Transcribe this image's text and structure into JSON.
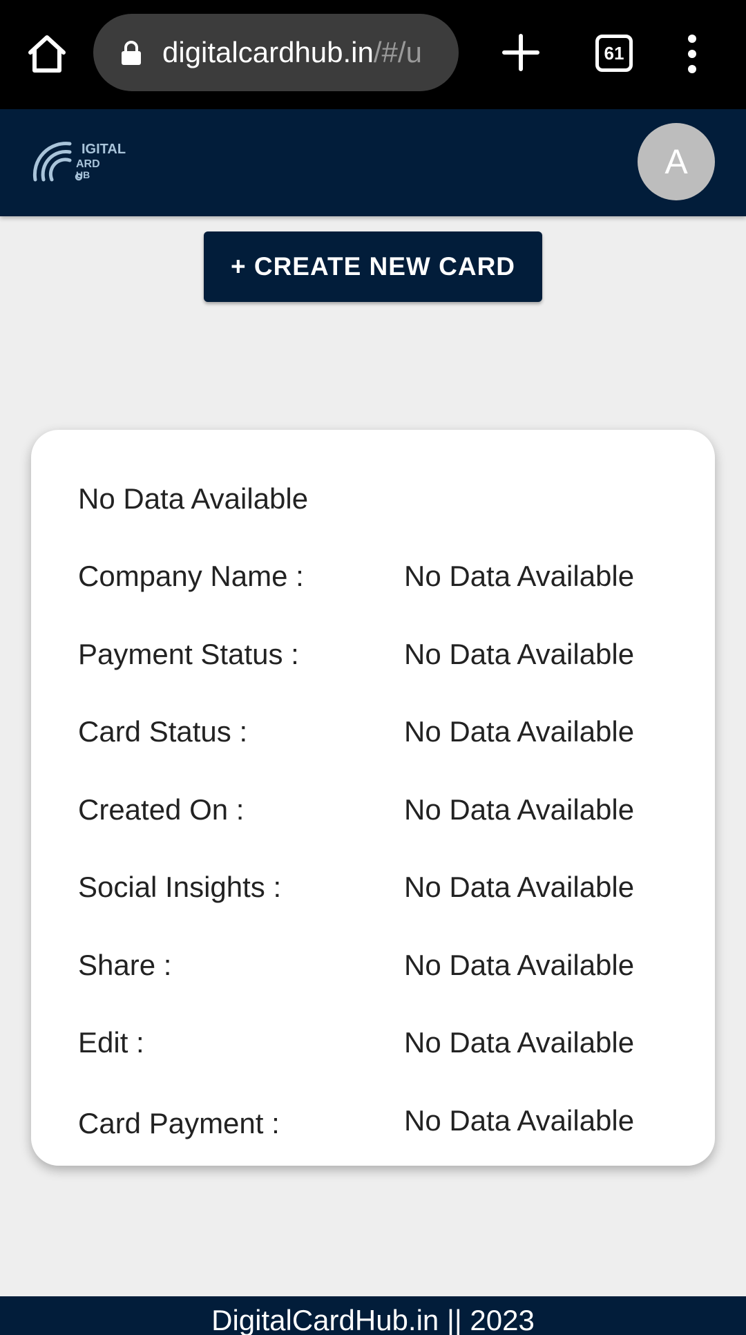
{
  "browser": {
    "url_main": "digitalcardhub.in",
    "url_rest": "/#/u",
    "tab_count": "61"
  },
  "header": {
    "logo_text": "DIGITAL CARD HUB",
    "avatar_letter": "A",
    "colors": {
      "navy": "#021d3a",
      "avatar_bg": "#bdbdbd"
    }
  },
  "actions": {
    "create_label": "+ CREATE NEW CARD"
  },
  "card": {
    "title": "No Data Available",
    "rows": [
      {
        "label": "Company Name :",
        "value": "No Data Available"
      },
      {
        "label": "Payment Status :",
        "value": "No Data Available"
      },
      {
        "label": "Card Status :",
        "value": "No Data Available"
      },
      {
        "label": "Created On :",
        "value": "No Data Available"
      },
      {
        "label": "Social Insights :",
        "value": "No Data Available"
      },
      {
        "label": "Share :",
        "value": "No Data Available"
      },
      {
        "label": "Edit :",
        "value": "No Data Available"
      },
      {
        "label": "Card Payment :",
        "value": "No Data Available"
      }
    ]
  },
  "footer": {
    "text": "DigitalCardHub.in || 2023"
  }
}
